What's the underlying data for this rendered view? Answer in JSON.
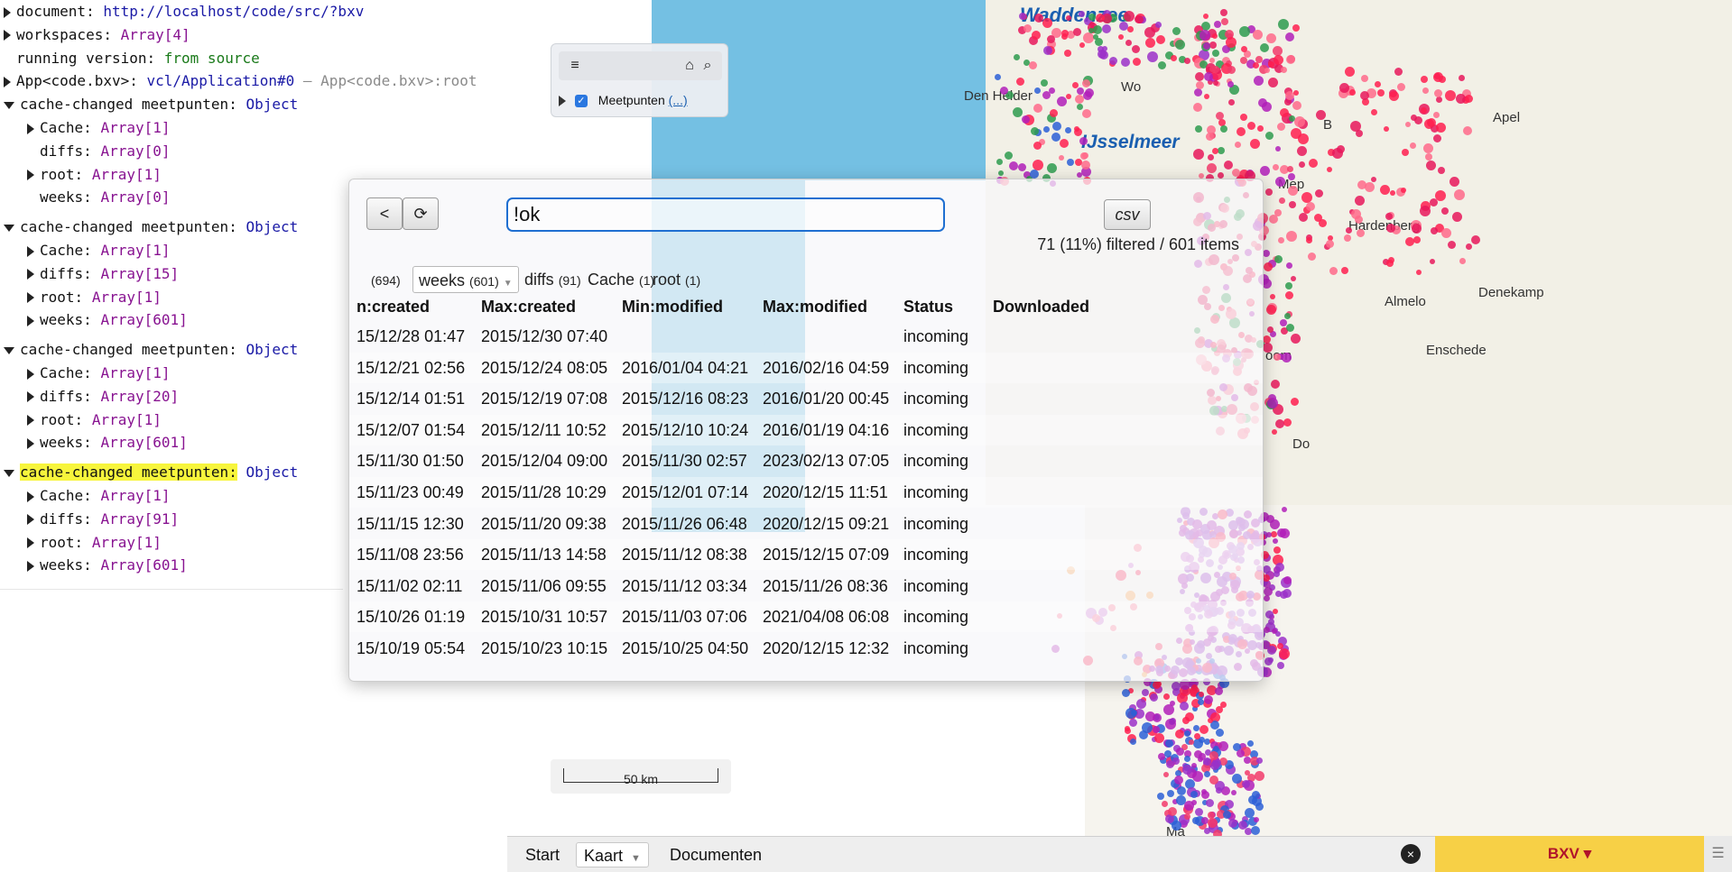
{
  "console": {
    "lines": [
      {
        "key": "document:",
        "value": "http://localhost/code/src/?bxv",
        "value_type": "link",
        "expanded": false
      },
      {
        "key": "workspaces:",
        "value": "Array[4]",
        "value_type": "array",
        "expanded": false
      },
      {
        "key": "running version:",
        "value": "from source",
        "value_type": "string"
      },
      {
        "key": "App<code.bxv>:",
        "value": "vcl/Application#0",
        "suffix": "– App<code.bxv>:root",
        "value_type": "link",
        "expanded": false
      }
    ],
    "groups": [
      {
        "label": "cache-changed meetpunten:",
        "type": "Object",
        "children": [
          {
            "key": "Cache:",
            "value": "Array[1]",
            "expandable": true
          },
          {
            "key": "diffs:",
            "value": "Array[0]",
            "expandable": false
          },
          {
            "key": "root:",
            "value": "Array[1]",
            "expandable": true
          },
          {
            "key": "weeks:",
            "value": "Array[0]",
            "expandable": false
          }
        ]
      },
      {
        "label": "cache-changed meetpunten:",
        "type": "Object",
        "children": [
          {
            "key": "Cache:",
            "value": "Array[1]",
            "expandable": true
          },
          {
            "key": "diffs:",
            "value": "Array[15]",
            "expandable": true
          },
          {
            "key": "root:",
            "value": "Array[1]",
            "expandable": true
          },
          {
            "key": "weeks:",
            "value": "Array[601]",
            "expandable": true
          }
        ]
      },
      {
        "label": "cache-changed meetpunten:",
        "type": "Object",
        "children": [
          {
            "key": "Cache:",
            "value": "Array[1]",
            "expandable": true
          },
          {
            "key": "diffs:",
            "value": "Array[20]",
            "expandable": true
          },
          {
            "key": "root:",
            "value": "Array[1]",
            "expandable": true
          },
          {
            "key": "weeks:",
            "value": "Array[601]",
            "expandable": true
          }
        ]
      },
      {
        "label": "cache-changed meetpunten:",
        "type": "Object",
        "highlighted": true,
        "children": [
          {
            "key": "Cache:",
            "value": "Array[1]",
            "expandable": true
          },
          {
            "key": "diffs:",
            "value": "Array[91]",
            "expandable": true
          },
          {
            "key": "root:",
            "value": "Array[1]",
            "expandable": true
          },
          {
            "key": "weeks:",
            "value": "Array[601]",
            "expandable": true
          }
        ]
      }
    ]
  },
  "map": {
    "labels": {
      "waddenzee": "Waddenzee",
      "ijsselmeer": "IJsselmeer",
      "den_helder": "Den Helder",
      "hardenberg": "Hardenberg",
      "denekamp": "Denekamp",
      "almelo": "Almelo",
      "enschede": "Enschede",
      "apel": "Apel",
      "meppel": "Mep",
      "woum": "Wo",
      "borne": "B",
      "do": "Do",
      "ma": "Ma",
      "oom": "oom"
    },
    "layer_panel": {
      "menu_icon": "hamburger-icon",
      "home_icon": "home-icon",
      "search_icon": "search-icon",
      "layer_name": "Meetpunten",
      "layer_link": "(...)",
      "checked": true
    },
    "scale": "50 km"
  },
  "dialog": {
    "back_label": "<",
    "refresh_icon": "refresh-icon",
    "search_value": "!ok",
    "csv_label": "csv",
    "count_text": "71 (11%) filtered / 601 items",
    "tabs": [
      {
        "label": "",
        "count": "(694)"
      },
      {
        "label": "weeks",
        "count": "(601)",
        "active": true
      },
      {
        "label": "diffs",
        "count": "(91)"
      },
      {
        "label": "Cache",
        "count": "(1)"
      },
      {
        "label": "root",
        "count": "(1)"
      }
    ],
    "columns": [
      "n:created",
      "Max:created",
      "Min:modified",
      "Max:modified",
      "Status",
      "Downloaded"
    ],
    "rows": [
      [
        "15/12/28 01:47",
        "2015/12/30 07:40",
        "",
        "",
        "incoming",
        ""
      ],
      [
        "15/12/21 02:56",
        "2015/12/24 08:05",
        "2016/01/04 04:21",
        "2016/02/16 04:59",
        "incoming",
        ""
      ],
      [
        "15/12/14 01:51",
        "2015/12/19 07:08",
        "2015/12/16 08:23",
        "2016/01/20 00:45",
        "incoming",
        ""
      ],
      [
        "15/12/07 01:54",
        "2015/12/11 10:52",
        "2015/12/10 10:24",
        "2016/01/19 04:16",
        "incoming",
        ""
      ],
      [
        "15/11/30 01:50",
        "2015/12/04 09:00",
        "2015/11/30 02:57",
        "2023/02/13 07:05",
        "incoming",
        ""
      ],
      [
        "15/11/23 00:49",
        "2015/11/28 10:29",
        "2015/12/01 07:14",
        "2020/12/15 11:51",
        "incoming",
        ""
      ],
      [
        "15/11/15 12:30",
        "2015/11/20 09:38",
        "2015/11/26 06:48",
        "2020/12/15 09:21",
        "incoming",
        ""
      ],
      [
        "15/11/08 23:56",
        "2015/11/13 14:58",
        "2015/11/12 08:38",
        "2015/12/15 07:09",
        "incoming",
        ""
      ],
      [
        "15/11/02 02:11",
        "2015/11/06 09:55",
        "2015/11/12 03:34",
        "2015/11/26 08:36",
        "incoming",
        ""
      ],
      [
        "15/10/26 01:19",
        "2015/10/31 10:57",
        "2015/11/03 07:06",
        "2021/04/08 06:08",
        "incoming",
        ""
      ],
      [
        "15/10/19 05:54",
        "2015/10/23 10:15",
        "2015/10/25 04:50",
        "2020/12/15 12:32",
        "incoming",
        ""
      ]
    ]
  },
  "bottom_tabs": {
    "start": "Start",
    "kaart": "Kaart",
    "documenten": "Documenten",
    "close_icon": "close-icon",
    "bxv": "BXV ▾",
    "menu_icon": "menu-icon"
  },
  "colors": {
    "sea": "#74c0e3",
    "accent": "#1f6fd1",
    "bxv_bg": "#f7d046",
    "bxv_text": "#b0142b",
    "highlight": "#f7f53c"
  }
}
